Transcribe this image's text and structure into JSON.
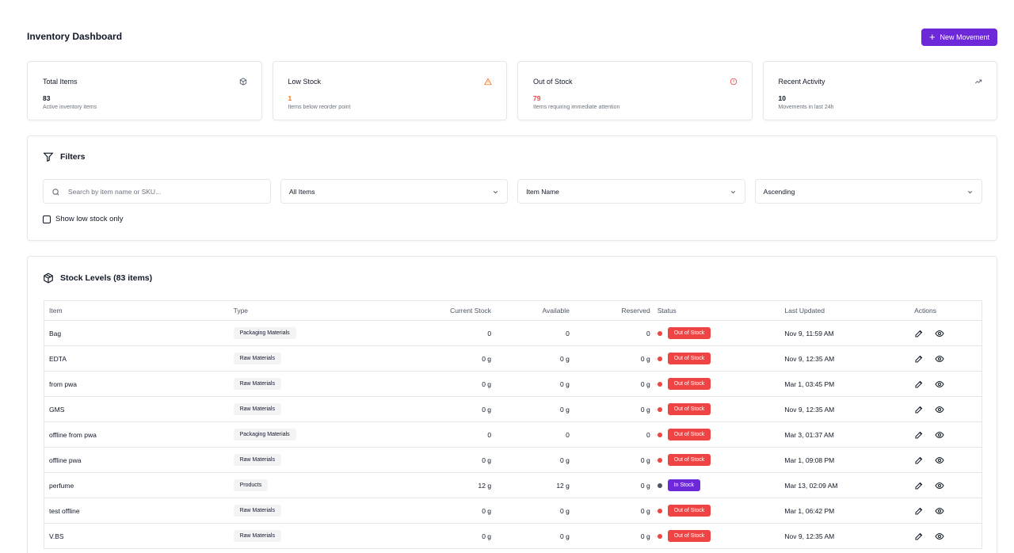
{
  "header": {
    "title": "Inventory Dashboard",
    "new_movement_label": "New Movement"
  },
  "stats": [
    {
      "title": "Total Items",
      "value": "83",
      "desc": "Active inventory items",
      "icon": "box-icon"
    },
    {
      "title": "Low Stock",
      "value": "1",
      "desc": "Items below reorder point",
      "icon": "warning-icon"
    },
    {
      "title": "Out of Stock",
      "value": "79",
      "desc": "Items requiring immediate attention",
      "icon": "alert-circle-icon"
    },
    {
      "title": "Recent Activity",
      "value": "10",
      "desc": "Movements in last 24h",
      "icon": "trending-up-icon"
    }
  ],
  "filters": {
    "title": "Filters",
    "search_placeholder": "Search by item name or SKU...",
    "item_filter": "All Items",
    "sort_by": "Item Name",
    "sort_order": "Ascending",
    "low_stock_label": "Show low stock only"
  },
  "stock": {
    "title": "Stock Levels (83 items)",
    "columns": [
      "Item",
      "Type",
      "Current Stock",
      "Available",
      "Reserved",
      "Status",
      "Last Updated",
      "Actions"
    ],
    "rows": [
      {
        "item": "Bag",
        "type": "Packaging Materials",
        "current": "0",
        "available": "0",
        "reserved": "0",
        "status": "Out of Stock",
        "updated": "Nov 9, 11:59 AM"
      },
      {
        "item": "EDTA",
        "type": "Raw Materials",
        "current": "0 g",
        "available": "0 g",
        "reserved": "0 g",
        "status": "Out of Stock",
        "updated": "Nov 9, 12:35 AM"
      },
      {
        "item": "from pwa",
        "type": "Raw Materials",
        "current": "0 g",
        "available": "0 g",
        "reserved": "0 g",
        "status": "Out of Stock",
        "updated": "Mar 1, 03:45 PM"
      },
      {
        "item": "GMS",
        "type": "Raw Materials",
        "current": "0 g",
        "available": "0 g",
        "reserved": "0 g",
        "status": "Out of Stock",
        "updated": "Nov 9, 12:35 AM"
      },
      {
        "item": "offline from pwa",
        "type": "Packaging Materials",
        "current": "0",
        "available": "0",
        "reserved": "0",
        "status": "Out of Stock",
        "updated": "Mar 3, 01:37 AM"
      },
      {
        "item": "offline pwa",
        "type": "Raw Materials",
        "current": "0 g",
        "available": "0 g",
        "reserved": "0 g",
        "status": "Out of Stock",
        "updated": "Mar 1, 09:08 PM"
      },
      {
        "item": "perfume",
        "type": "Products",
        "current": "12 g",
        "available": "12 g",
        "reserved": "0 g",
        "status": "In Stock",
        "updated": "Mar 13, 02:09 AM"
      },
      {
        "item": "test offline",
        "type": "Raw Materials",
        "current": "0 g",
        "available": "0 g",
        "reserved": "0 g",
        "status": "Out of Stock",
        "updated": "Mar 1, 06:42 PM"
      },
      {
        "item": "V.BS",
        "type": "Raw Materials",
        "current": "0 g",
        "available": "0 g",
        "reserved": "0 g",
        "status": "Out of Stock",
        "updated": "Nov 9, 12:35 AM"
      }
    ]
  },
  "colors": {
    "accent": "#6d28d9",
    "danger": "#ef4444",
    "warning": "#f97316"
  }
}
